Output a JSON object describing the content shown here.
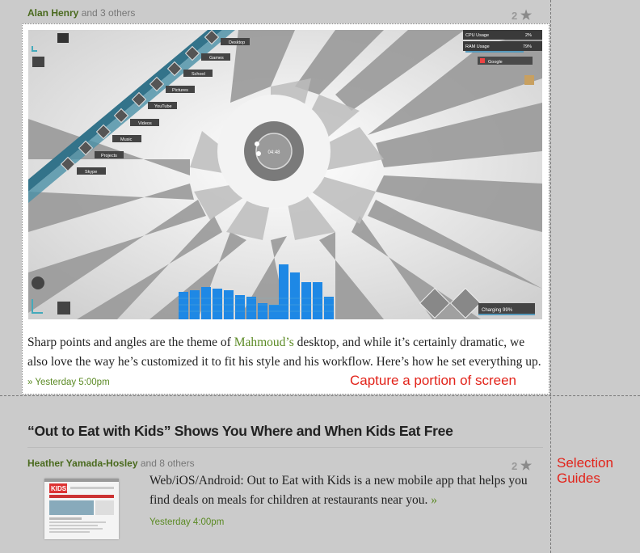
{
  "post1": {
    "author": "Alan Henry",
    "others": " and 3 others",
    "star_count": "2",
    "star_icon": "★",
    "body_before": "Sharp points and angles are the theme of ",
    "body_link": "Mahmoud’s",
    "body_after": " desktop, and while it’s certainly dramatic, we also love the way he’s customized it to fit his style and his workflow. Here’s how he set everything up. ",
    "timestamp": "» Yesterday 5:00pm"
  },
  "screenshot": {
    "menu_items": [
      "Desktop",
      "Games",
      "School",
      "Pictures",
      "YouTube",
      "Videos",
      "Music",
      "Projects",
      "Skype"
    ],
    "cpu_label": "CPU Usage",
    "cpu_value": "2%",
    "ram_label": "RAM Usage",
    "ram_value": "79%",
    "google_label": "Google",
    "clock_time": "04:48",
    "battery_text": "Charging 99%"
  },
  "annotations": {
    "capture": "Capture a portion of screen",
    "guides_line1": "Selection",
    "guides_line2": "Guides"
  },
  "post2": {
    "headline": "“Out to Eat with Kids” Shows You Where and When Kids Eat Free",
    "author": "Heather Yamada-Hosley",
    "others": " and 8 others",
    "star_count": "2",
    "star_icon": "★",
    "body": "Web/iOS/Android: Out to Eat with Kids is a new mobile app that helps you find deals on meals for children at restaurants near you. ",
    "arrow": "»",
    "timestamp": "Yesterday 4:00pm",
    "thumb_text": "KIDS!"
  }
}
